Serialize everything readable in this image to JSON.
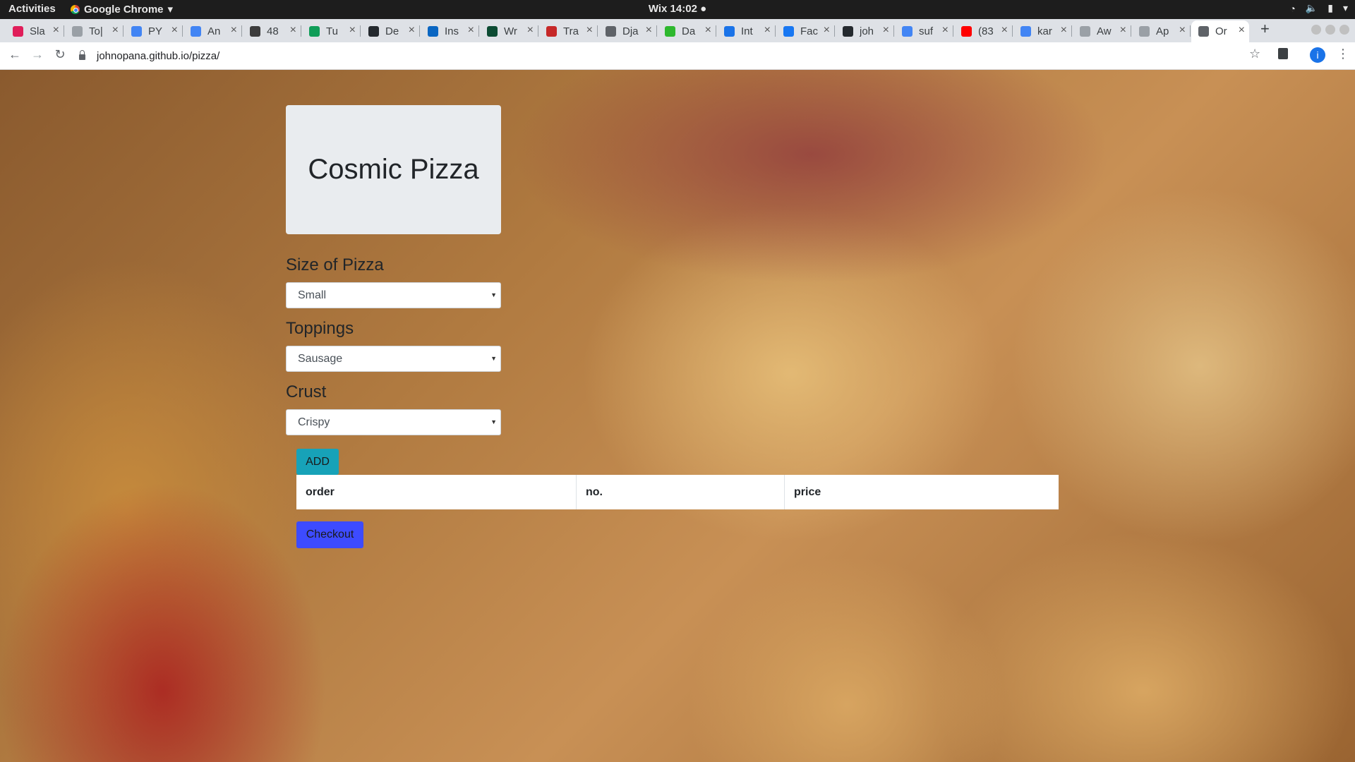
{
  "topbar": {
    "activities": "Activities",
    "app_name": "Google Chrome",
    "app_caret": "▾",
    "clock": "Wix 14:02 ●",
    "tray_icons": [
      "wifi-icon",
      "volume-icon",
      "battery-icon",
      "chevron-down-icon"
    ]
  },
  "tabs": [
    {
      "title": "Sla",
      "color": "#e01e5a"
    },
    {
      "title": "To|",
      "color": "#9aa0a6"
    },
    {
      "title": "PY",
      "color": "#4285f4"
    },
    {
      "title": "An",
      "color": "#4285f4"
    },
    {
      "title": "48",
      "color": "#3c3c3c"
    },
    {
      "title": "Tu",
      "color": "#0f9d58"
    },
    {
      "title": "De",
      "color": "#24292e"
    },
    {
      "title": "Ins",
      "color": "#0a66c2"
    },
    {
      "title": "Wr",
      "color": "#0c4b33"
    },
    {
      "title": "Tra",
      "color": "#c62828"
    },
    {
      "title": "Dja",
      "color": "#5f6368"
    },
    {
      "title": "Da",
      "color": "#2eb82e"
    },
    {
      "title": "Int",
      "color": "#1a73e8"
    },
    {
      "title": "Fac",
      "color": "#1877f2"
    },
    {
      "title": "joh",
      "color": "#24292e"
    },
    {
      "title": "suf",
      "color": "#4285f4"
    },
    {
      "title": "(83",
      "color": "#ff0000"
    },
    {
      "title": "kar",
      "color": "#4285f4"
    },
    {
      "title": "Aw",
      "color": "#9aa0a6"
    },
    {
      "title": "Ap",
      "color": "#9aa0a6"
    },
    {
      "title": "Or",
      "color": "#5f6368",
      "active": true
    }
  ],
  "newtab_label": "+",
  "nav": {
    "back": "←",
    "forward": "→",
    "reload": "↻",
    "url": "johnopana.github.io/pizza/",
    "star": "☆",
    "profile_initial": "i",
    "menu": "⋮"
  },
  "page": {
    "title": "Cosmic Pizza",
    "size": {
      "label": "Size of Pizza",
      "selected": "Small"
    },
    "toppings": {
      "label": "Toppings",
      "selected": "Sausage"
    },
    "crust": {
      "label": "Crust",
      "selected": "Crispy"
    },
    "add_label": "ADD",
    "table_headers": [
      "order",
      "no.",
      "price"
    ],
    "checkout_label": "Checkout",
    "colors": {
      "add_button": "#17a2b8",
      "checkout_button": "#3d4bff",
      "jumbotron": "#e9ecef"
    }
  }
}
